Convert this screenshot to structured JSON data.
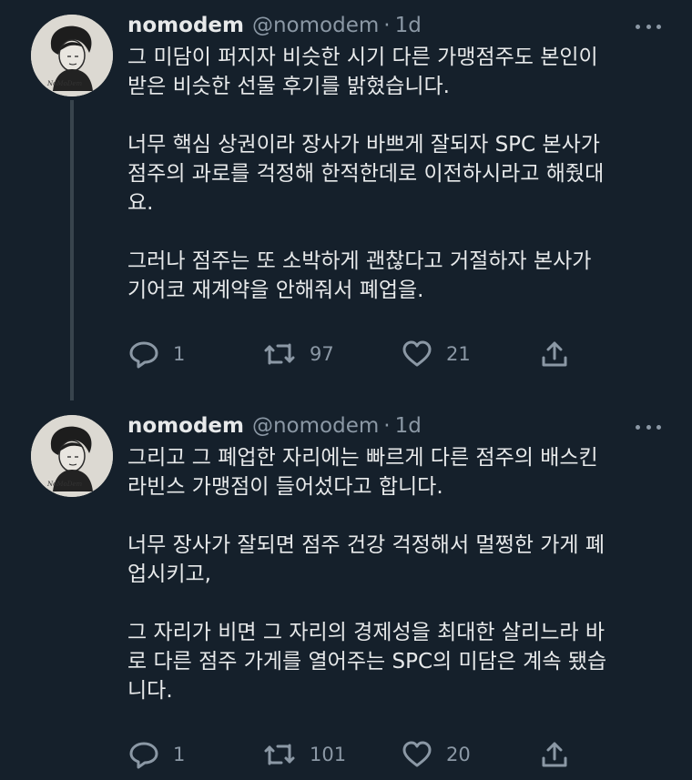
{
  "tweets": [
    {
      "author": {
        "name": "nomodem",
        "handle": "@nomodem",
        "avatar_caption": "NoMoDem"
      },
      "separator": "·",
      "time": "1d",
      "paragraphs": [
        "그 미담이 퍼지자 비슷한 시기 다른 가맹점주도 본인이\n받은 비슷한 선물 후기를 밝혔습니다.",
        "너무 핵심 상권이라 장사가 바쁘게 잘되자 SPC 본사가\n점주의 과로를 걱정해 한적한데로 이전하시라고 해줬대\n요.",
        "그러나 점주는 또 소박하게 괜찮다고 거절하자 본사가\n기어코 재계약을 안해줘서 폐업을."
      ],
      "stats": {
        "replies": "1",
        "retweets": "97",
        "likes": "21"
      }
    },
    {
      "author": {
        "name": "nomodem",
        "handle": "@nomodem",
        "avatar_caption": "NoMoDem"
      },
      "separator": "·",
      "time": "1d",
      "paragraphs": [
        "그리고 그 폐업한 자리에는 빠르게 다른 점주의 배스킨\n라빈스 가맹점이 들어섰다고 합니다.",
        "너무 장사가 잘되면 점주 건강 걱정해서 멀쩡한 가게 폐\n업시키고,",
        "그 자리가 비면 그 자리의 경제성을 최대한 살리느라 바\n로 다른 점주 가게를 열어주는 SPC의 미담은 계속 됐습\n니다."
      ],
      "stats": {
        "replies": "1",
        "retweets": "101",
        "likes": "20"
      }
    }
  ],
  "icons": {
    "reply": "reply-icon",
    "retweet": "retweet-icon",
    "like": "heart-icon",
    "share": "share-icon",
    "more": "more-options-icon"
  },
  "colors": {
    "background": "#15202b",
    "text": "#e7e9ea",
    "secondary": "#8b98a5",
    "thread_line": "#38444d"
  }
}
